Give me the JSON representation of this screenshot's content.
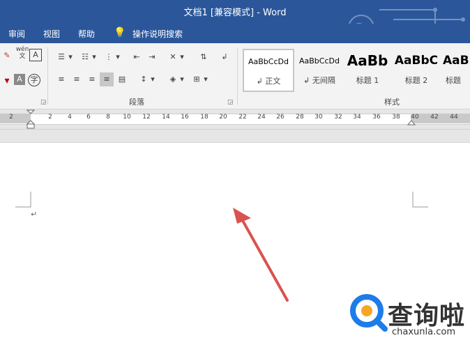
{
  "window": {
    "title": "文档1 [兼容模式]  -  Word"
  },
  "menu": {
    "review": "审阅",
    "view": "视图",
    "help": "帮助",
    "tell_me": "操作说明搜索"
  },
  "ribbon": {
    "paragraph_label": "段落",
    "styles_label": "样式",
    "styles": [
      {
        "preview": "AaBbCcDd",
        "name": "↲ 正文"
      },
      {
        "preview": "AaBbCcDd",
        "name": "↲ 无间隔"
      },
      {
        "preview": "AaBb",
        "name": "标题 1"
      },
      {
        "preview": "AaBbC",
        "name": "标题 2"
      },
      {
        "preview": "AaB",
        "name": "标题"
      }
    ],
    "wen_glyph": "wén",
    "wen_char": "文",
    "zi_char": "字",
    "font_A": "A"
  },
  "ruler": {
    "ticks": [
      "2",
      "",
      "2",
      "4",
      "6",
      "8",
      "10",
      "12",
      "14",
      "16",
      "18",
      "20",
      "22",
      "24",
      "26",
      "28",
      "30",
      "32",
      "34",
      "36",
      "38",
      "40",
      "42",
      "44"
    ]
  },
  "document": {
    "paragraph_mark": "↵"
  },
  "watermark": {
    "brand": "查询啦",
    "url": "chaxunla.com"
  },
  "colors": {
    "titlebar": "#2b579a",
    "arrow": "#d9534f",
    "logo": "#1e7ce8"
  }
}
